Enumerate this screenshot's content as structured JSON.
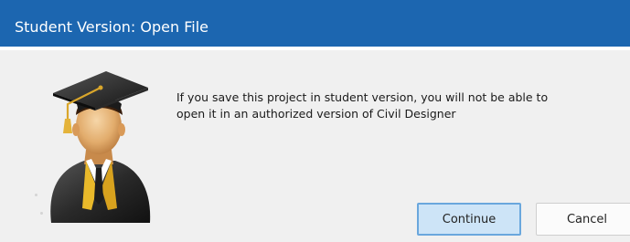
{
  "window": {
    "title": "Student Version: Open File"
  },
  "message": {
    "line1": "If you save this project in student version, you will not be able to",
    "line2": "open it in an authorized version of Civil Designer"
  },
  "buttons": {
    "continue_label": "Continue",
    "cancel_label": "Cancel"
  },
  "icon": {
    "name": "graduate-student-icon"
  },
  "colors": {
    "titlebar": "#1c66b0",
    "body": "#f0f0f0",
    "default_button_fill": "#cde4f7",
    "default_button_border": "#6aa7dd"
  }
}
